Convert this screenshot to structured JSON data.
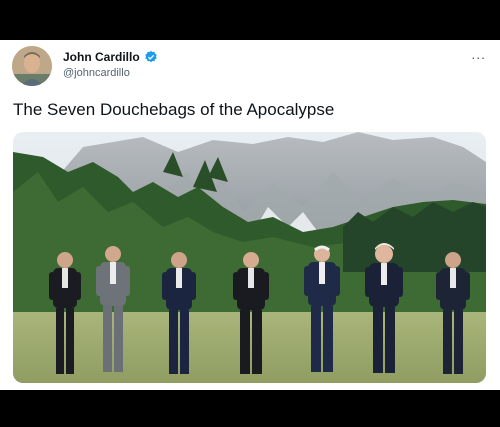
{
  "tweet": {
    "display_name": "John Cardillo",
    "handle": "@johncardillo",
    "text": "The Seven Douchebags of the Apocalypse",
    "verified": true,
    "more_menu": "..."
  },
  "colors": {
    "verified_badge": "#1d9bf0",
    "name_text": "#0f1419",
    "handle_text": "#536471"
  },
  "icons": [
    "verified-badge-icon",
    "more-options-icon",
    "avatar"
  ]
}
